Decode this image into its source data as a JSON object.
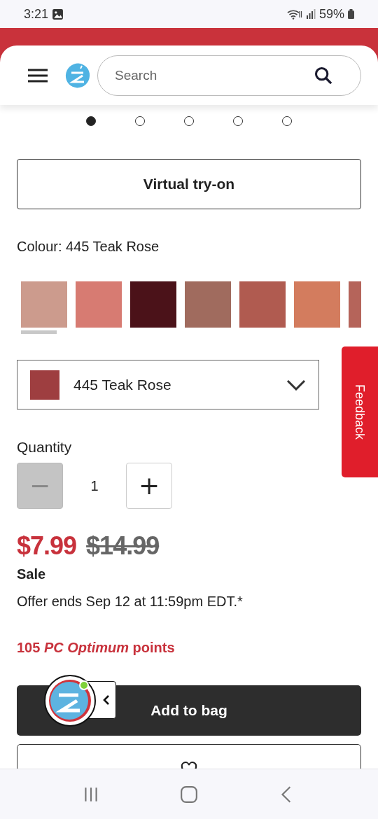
{
  "status_bar": {
    "time": "3:21",
    "battery": "59%"
  },
  "header": {
    "search": {
      "placeholder": "Search"
    }
  },
  "carousel_dots": [
    {
      "selected": true
    },
    {
      "selected": false
    },
    {
      "selected": false
    },
    {
      "selected": false
    },
    {
      "selected": false
    }
  ],
  "virtual_try_on": "Virtual try-on",
  "colour_label": "Colour: 445 Teak Rose",
  "swatches": [
    {
      "color": "#cc9b8d",
      "selected": true
    },
    {
      "color": "#d77b72",
      "selected": false
    },
    {
      "color": "#4b1219",
      "selected": false
    },
    {
      "color": "#a06b5e",
      "selected": false
    },
    {
      "color": "#b05b50",
      "selected": false
    },
    {
      "color": "#d37c5e",
      "selected": false
    },
    {
      "color": "#b5645a",
      "selected": false
    }
  ],
  "shade_dropdown": {
    "value": "445 Teak Rose",
    "color": "#9e3e40"
  },
  "feedback_tab": "Feedback",
  "quantity": {
    "label": "Quantity",
    "value": "1",
    "decrease_disabled": true,
    "decrease": "−",
    "increase": "+"
  },
  "price": {
    "sale": "$7.99",
    "original": "$14.99",
    "badge": "Sale",
    "offer": "Offer ends Sep 12 at 11:59pm EDT.*",
    "points": "105 *PC Optimum* points"
  },
  "buttons": [
    {
      "kind": "primary",
      "label": "Add to bag"
    },
    {
      "kind": "favourite"
    }
  ],
  "chat_widget": {
    "online": true
  }
}
